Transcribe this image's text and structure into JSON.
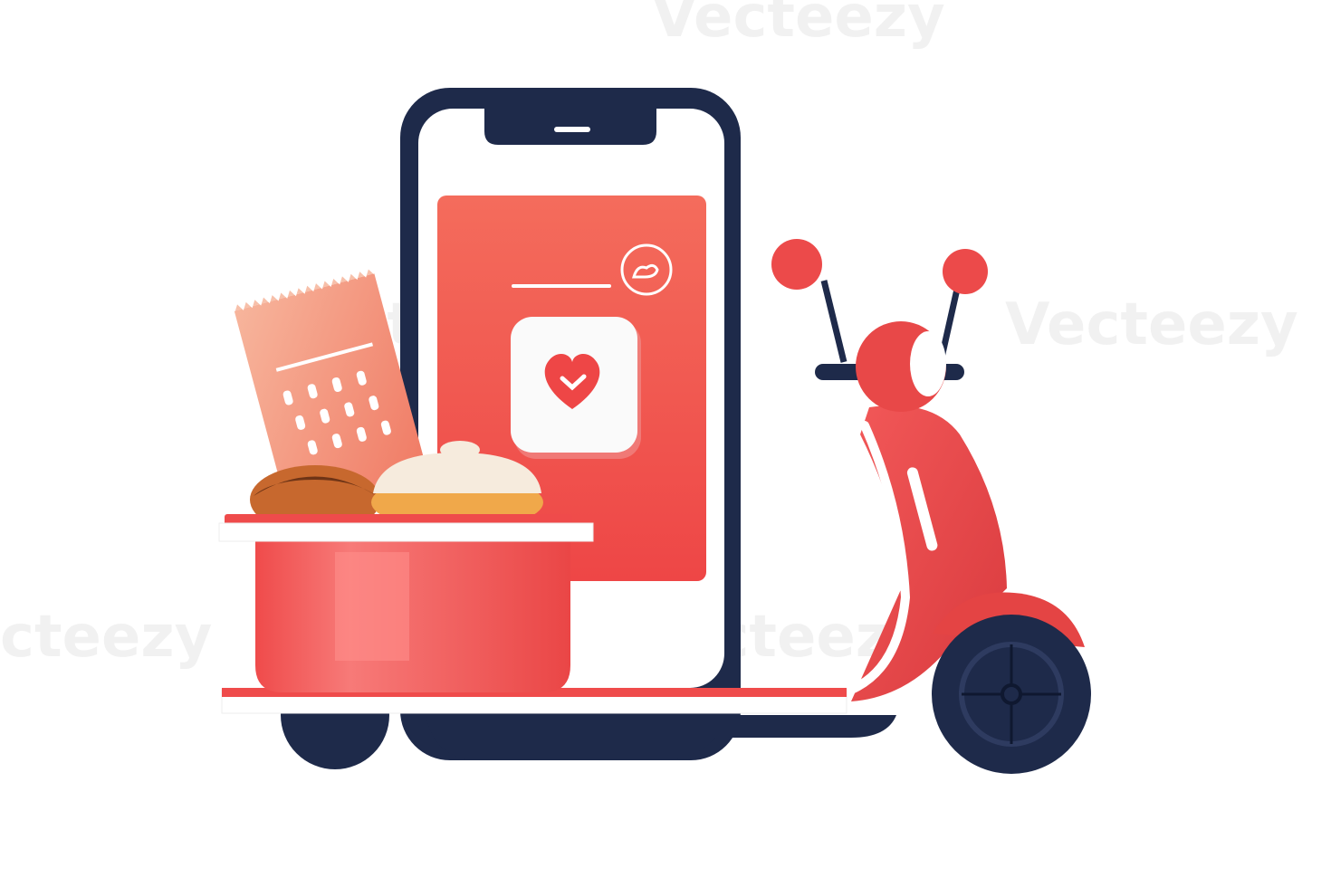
{
  "illustration": {
    "subject": "food delivery",
    "watermark_text": "Vecteezy"
  },
  "colors": {
    "navy": "#1e2a4a",
    "red": "#ef4b4b",
    "coral": "#f26a5c",
    "peach": "#f4a58a",
    "white": "#ffffff",
    "bun_brown": "#b5562a",
    "bun_cream": "#f6e7d6"
  },
  "icons": [
    "smartphone",
    "heart-app-icon",
    "receipt",
    "food-bowl",
    "scooter"
  ]
}
